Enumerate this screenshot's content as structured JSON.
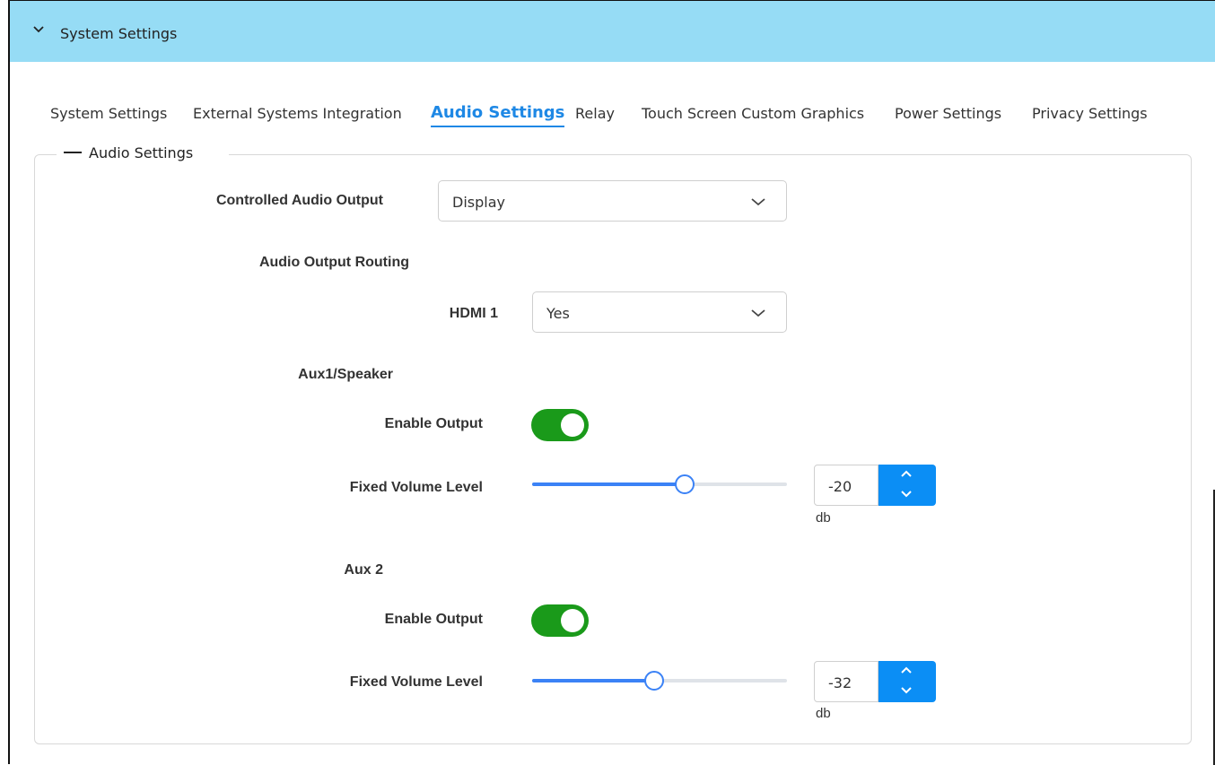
{
  "header": {
    "title": "System Settings"
  },
  "tabs": [
    {
      "label": "System Settings"
    },
    {
      "label": "External Systems Integration"
    },
    {
      "label": "Audio Settings"
    },
    {
      "label": "Relay"
    },
    {
      "label": "Touch Screen Custom Graphics"
    },
    {
      "label": "Power Settings"
    },
    {
      "label": "Privacy Settings"
    }
  ],
  "active_tab": "Audio Settings",
  "section": {
    "legend": "Audio Settings",
    "controlled_audio_output": {
      "label": "Controlled Audio Output",
      "value": "Display"
    },
    "routing": {
      "label": "Audio Output Routing",
      "hdmi1": {
        "label": "HDMI 1",
        "value": "Yes"
      }
    },
    "aux1": {
      "title": "Aux1/Speaker",
      "enable_label": "Enable Output",
      "enabled": true,
      "volume_label": "Fixed Volume Level",
      "volume_value": "-20",
      "volume_fraction": 0.6,
      "unit": "db"
    },
    "aux2": {
      "title": "Aux 2",
      "enable_label": "Enable Output",
      "enabled": true,
      "volume_label": "Fixed Volume Level",
      "volume_value": "-32",
      "volume_fraction": 0.48,
      "unit": "db"
    }
  },
  "colors": {
    "header_bg": "#96dcf5",
    "accent": "#1e88e5",
    "toggle_on": "#1a9a1a",
    "spin_bg": "#0b8ef5"
  }
}
